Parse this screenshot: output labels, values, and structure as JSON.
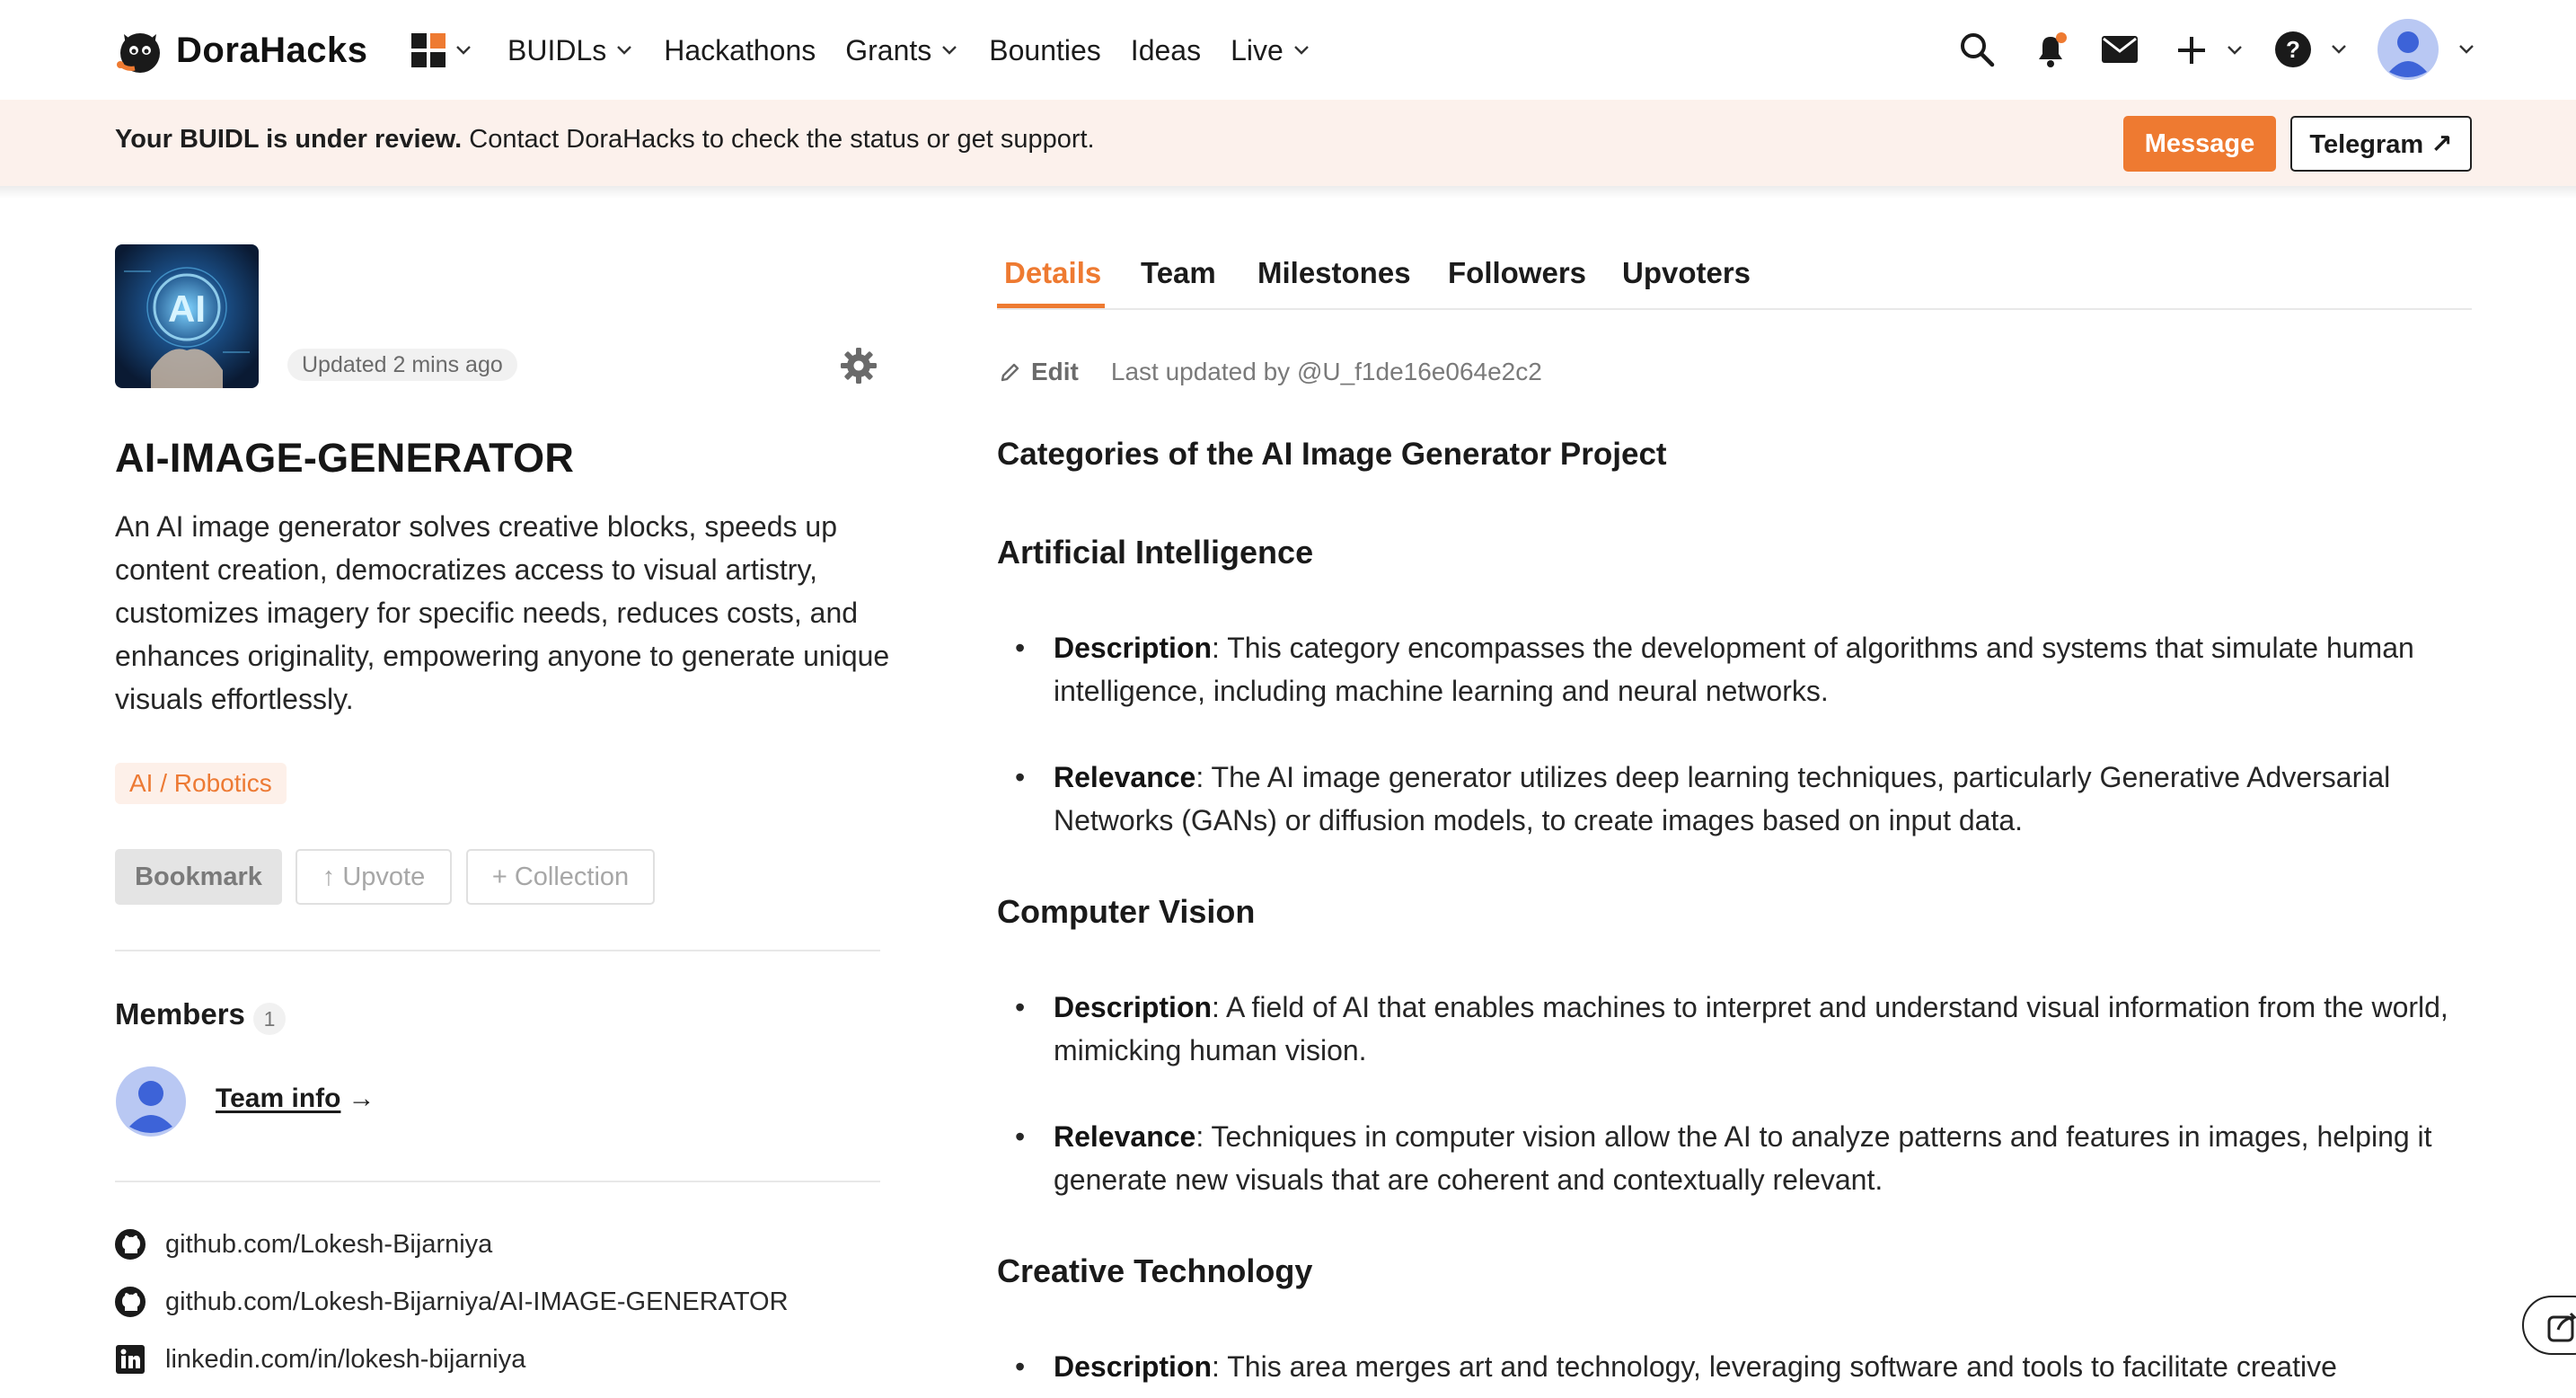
{
  "header": {
    "brand": "DoraHacks",
    "nav": [
      {
        "label": "BUIDLs",
        "has_dropdown": true
      },
      {
        "label": "Hackathons",
        "has_dropdown": false
      },
      {
        "label": "Grants",
        "has_dropdown": true
      },
      {
        "label": "Bounties",
        "has_dropdown": false
      },
      {
        "label": "Ideas",
        "has_dropdown": false
      },
      {
        "label": "Live",
        "has_dropdown": true
      }
    ],
    "icons": [
      "apps-grid-icon",
      "search-icon",
      "bell-icon",
      "mail-icon",
      "plus-icon",
      "help-icon",
      "avatar"
    ]
  },
  "banner": {
    "bold": "Your BUIDL is under review.",
    "text": " Contact DoraHacks to check the status or get support.",
    "message_button": "Message",
    "telegram_button": "Telegram ↗"
  },
  "project": {
    "updated": "Updated 2 mins ago",
    "title": "AI-IMAGE-GENERATOR",
    "description": "An AI image generator solves creative blocks, speeds up content creation, democratizes access to visual artistry, customizes imagery for specific needs, reduces costs, and enhances originality, empowering anyone to generate unique visuals effortlessly.",
    "tag": "AI / Robotics",
    "actions": {
      "bookmark": "Bookmark",
      "upvote": "↑ Upvote",
      "collection": "+ Collection"
    },
    "members_label": "Members",
    "members_count": "1",
    "team_info": "Team info",
    "team_info_arrow": "→",
    "links": [
      {
        "icon": "github-icon",
        "text": "github.com/Lokesh-Bijarniya"
      },
      {
        "icon": "github-icon",
        "text": "github.com/Lokesh-Bijarniya/AI-IMAGE-GENERATOR"
      },
      {
        "icon": "linkedin-icon",
        "text": "linkedin.com/in/lokesh-bijarniya"
      }
    ]
  },
  "tabs": [
    {
      "label": "Details",
      "active": true
    },
    {
      "label": "Team",
      "active": false
    },
    {
      "label": "Milestones",
      "active": false
    },
    {
      "label": "Followers",
      "active": false
    },
    {
      "label": "Upvoters",
      "active": false
    }
  ],
  "details": {
    "edit_label": "Edit",
    "last_updated": "Last updated by @U_f1de16e064e2c2",
    "heading": "Categories of the AI Image Generator Project",
    "sections": [
      {
        "title": "Artificial Intelligence",
        "bullets": [
          {
            "key": "Description",
            "text": ": This category encompasses the development of algorithms and systems that simulate human intelligence, including machine learning and neural networks."
          },
          {
            "key": "Relevance",
            "text": ": The AI image generator utilizes deep learning techniques, particularly Generative Adversarial Networks (GANs) or diffusion models, to create images based on input data."
          }
        ]
      },
      {
        "title": "Computer Vision",
        "bullets": [
          {
            "key": "Description",
            "text": ": A field of AI that enables machines to interpret and understand visual information from the world, mimicking human vision."
          },
          {
            "key": "Relevance",
            "text": ": Techniques in computer vision allow the AI to analyze patterns and features in images, helping it generate new visuals that are coherent and contextually relevant."
          }
        ]
      },
      {
        "title": "Creative Technology",
        "bullets": [
          {
            "key": "Description",
            "text": ": This area merges art and technology, leveraging software and tools to facilitate creative"
          }
        ]
      }
    ]
  },
  "colors": {
    "accent": "#ee7a31",
    "banner_bg": "#fcf1ec",
    "tag_bg": "#fdf0e9"
  }
}
